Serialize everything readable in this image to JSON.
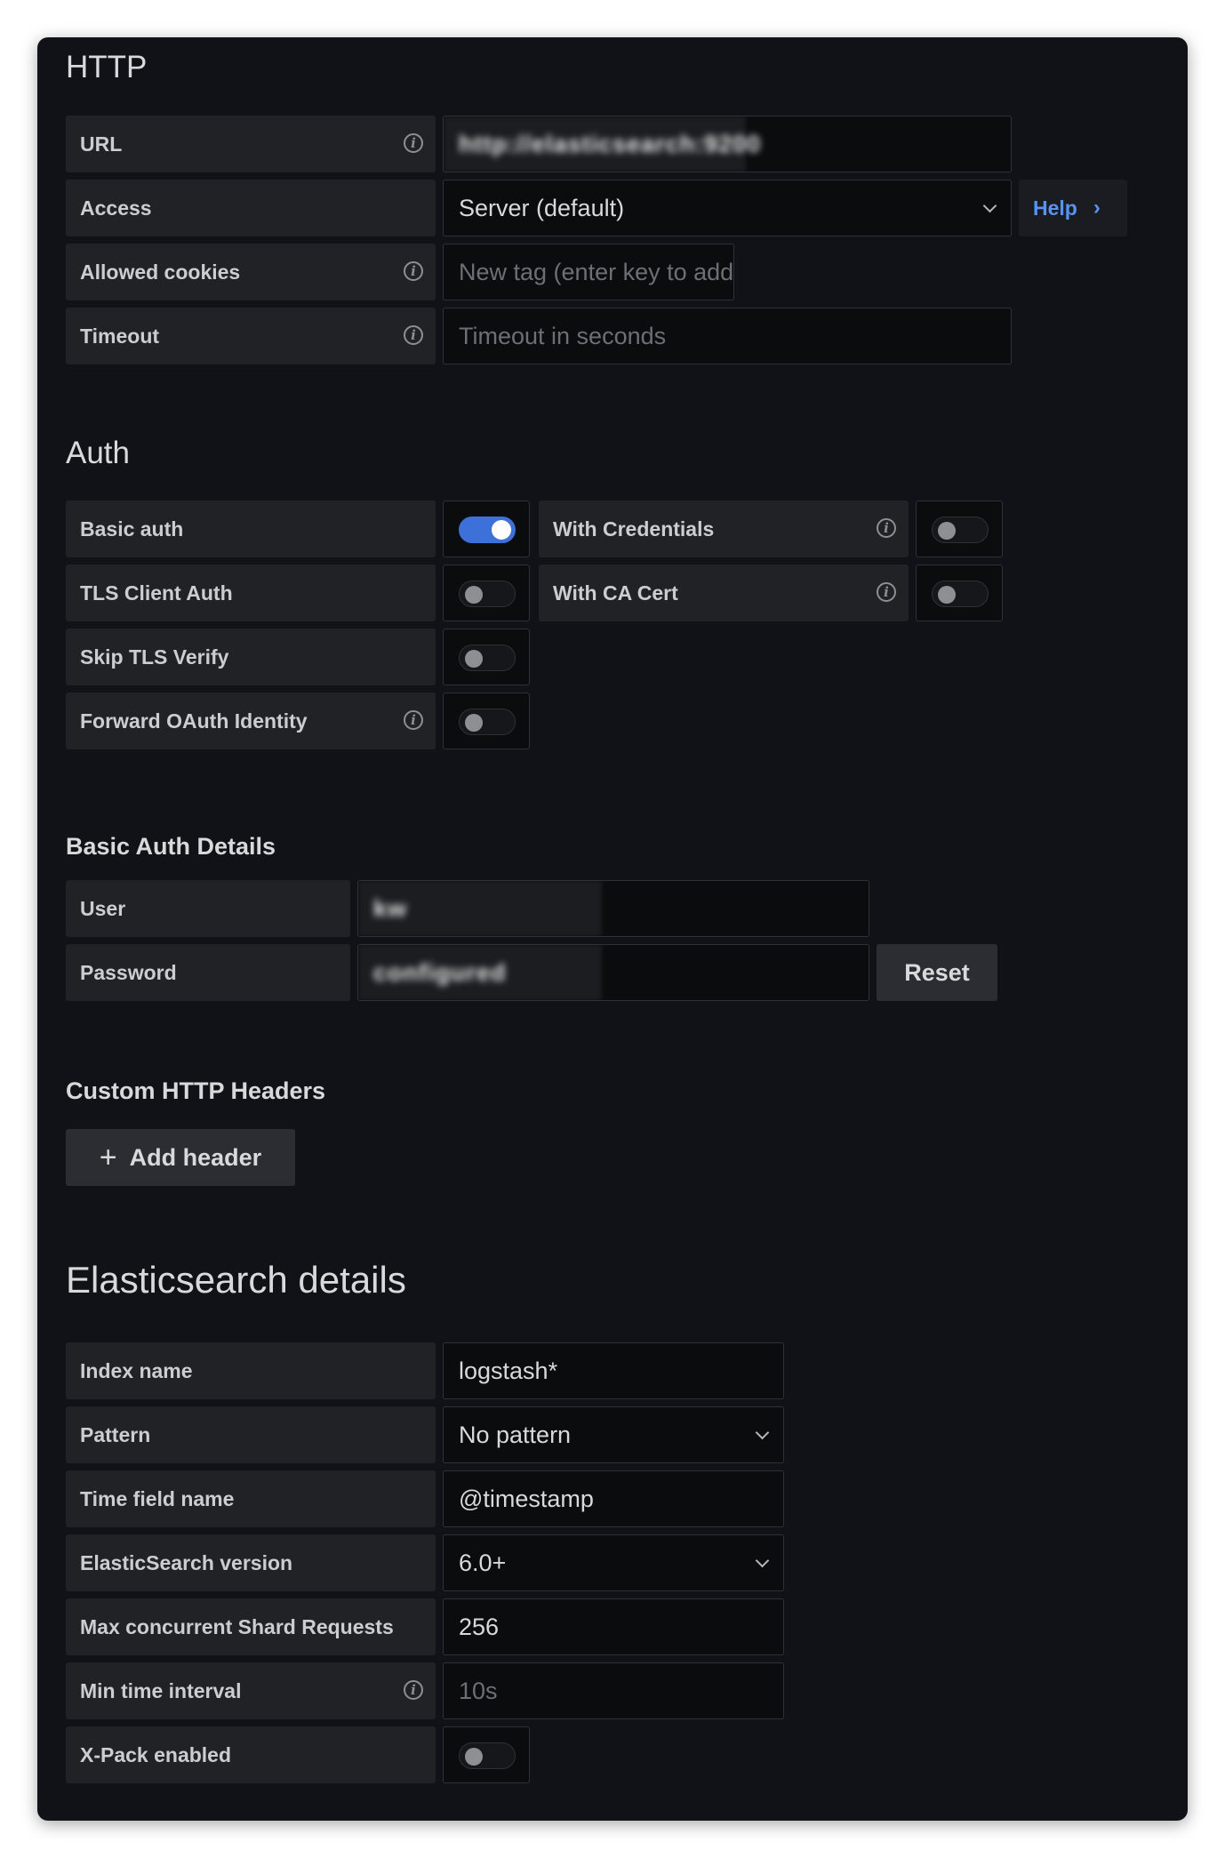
{
  "http": {
    "title": "HTTP",
    "url": {
      "label": "URL",
      "value": "http://elasticsearch:9200"
    },
    "access": {
      "label": "Access",
      "value": "Server (default)",
      "help": "Help"
    },
    "allowed_cookies": {
      "label": "Allowed cookies",
      "placeholder": "New tag (enter key to add)"
    },
    "timeout": {
      "label": "Timeout",
      "placeholder": "Timeout in seconds"
    }
  },
  "auth": {
    "title": "Auth",
    "basic_auth": {
      "label": "Basic auth",
      "enabled": true
    },
    "with_credentials": {
      "label": "With Credentials",
      "enabled": false
    },
    "tls_client_auth": {
      "label": "TLS Client Auth",
      "enabled": false
    },
    "with_ca_cert": {
      "label": "With CA Cert",
      "enabled": false
    },
    "skip_tls_verify": {
      "label": "Skip TLS Verify",
      "enabled": false
    },
    "forward_oauth": {
      "label": "Forward OAuth Identity",
      "enabled": false
    }
  },
  "basic_auth_details": {
    "title": "Basic Auth Details",
    "user": {
      "label": "User",
      "value": "kw"
    },
    "password": {
      "label": "Password",
      "value": "configured",
      "reset": "Reset"
    }
  },
  "custom_headers": {
    "title": "Custom HTTP Headers",
    "add_button": "Add header"
  },
  "elasticsearch": {
    "title": "Elasticsearch details",
    "index_name": {
      "label": "Index name",
      "value": "logstash*"
    },
    "pattern": {
      "label": "Pattern",
      "value": "No pattern"
    },
    "time_field": {
      "label": "Time field name",
      "value": "@timestamp"
    },
    "version": {
      "label": "ElasticSearch version",
      "value": "6.0+"
    },
    "max_shard": {
      "label": "Max concurrent Shard Requests",
      "value": "256"
    },
    "min_interval": {
      "label": "Min time interval",
      "placeholder": "10s"
    },
    "xpack": {
      "label": "X-Pack enabled",
      "enabled": false
    }
  },
  "icons": {
    "info": "info-circle-icon",
    "dropdown": "chevron-down-icon",
    "help": "chevron-right-icon",
    "add": "plus-icon"
  },
  "colors": {
    "background": "#111217",
    "label_bg": "#202226",
    "input_bg": "#0b0c0e",
    "accent": "#3d71d9",
    "link": "#5794f2"
  }
}
